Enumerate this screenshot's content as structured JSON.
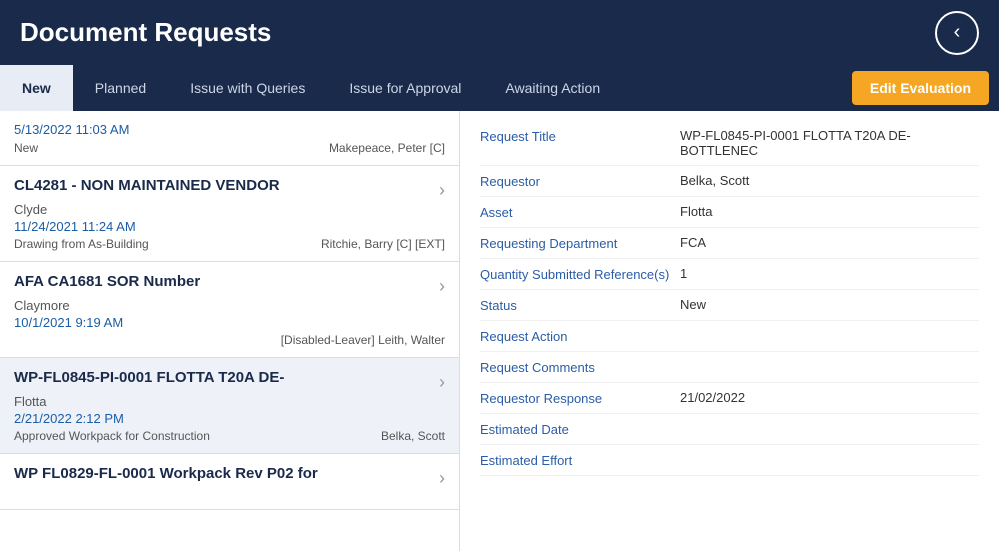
{
  "header": {
    "title": "Document Requests",
    "back_label": "‹"
  },
  "tabs": [
    {
      "id": "new",
      "label": "New",
      "active": true
    },
    {
      "id": "planned",
      "label": "Planned",
      "active": false
    },
    {
      "id": "issue-with-queries",
      "label": "Issue with Queries",
      "active": false
    },
    {
      "id": "issue-for-approval",
      "label": "Issue for Approval",
      "active": false
    },
    {
      "id": "awaiting-action",
      "label": "Awaiting Action",
      "active": false
    }
  ],
  "edit_evaluation_label": "Edit Evaluation",
  "list": {
    "items": [
      {
        "id": "item-top",
        "partial": true,
        "date": "5/13/2022 11:03 AM",
        "status": "New",
        "person": "Makepeace, Peter [C]"
      },
      {
        "id": "item-cl4281",
        "title": "CL4281 - NON MAINTAINED VENDOR",
        "subtitle": "Clyde",
        "date": "11/24/2021 11:24 AM",
        "type": "Drawing from As-Building",
        "person": "Ritchie, Barry [C] [EXT]",
        "selected": false
      },
      {
        "id": "item-afa",
        "title": "AFA CA1681 SOR Number",
        "subtitle": "Claymore",
        "date": "10/1/2021 9:19 AM",
        "type": "",
        "person": "[Disabled-Leaver] Leith, Walter",
        "selected": false
      },
      {
        "id": "item-wp-fl0845",
        "title": "WP-FL0845-PI-0001 FLOTTA T20A DE-",
        "subtitle": "Flotta",
        "date": "2/21/2022 2:12 PM",
        "type": "Approved Workpack for Construction",
        "person": "Belka, Scott",
        "selected": true
      },
      {
        "id": "item-wp-fl0829",
        "title": "WP FL0829-FL-0001 Workpack Rev P02 for",
        "subtitle": "",
        "date": "",
        "type": "",
        "person": "",
        "selected": false,
        "partial_bottom": true
      }
    ]
  },
  "detail": {
    "fields": [
      {
        "label": "Request Title",
        "value": "WP-FL0845-PI-0001 FLOTTA T20A DE-BOTTLENEC"
      },
      {
        "label": "Requestor",
        "value": "Belka, Scott"
      },
      {
        "label": "Asset",
        "value": "Flotta"
      },
      {
        "label": "Requesting Department",
        "value": "FCA"
      },
      {
        "label": "Quantity Submitted Reference(s)",
        "value": "1"
      },
      {
        "label": "Status",
        "value": "New"
      },
      {
        "label": "Request Action",
        "value": ""
      },
      {
        "label": "Request Comments",
        "value": ""
      },
      {
        "label": "Requestor Response",
        "value": "21/02/2022"
      },
      {
        "label": "Estimated Date",
        "value": ""
      },
      {
        "label": "Estimated Effort",
        "value": ""
      }
    ]
  }
}
